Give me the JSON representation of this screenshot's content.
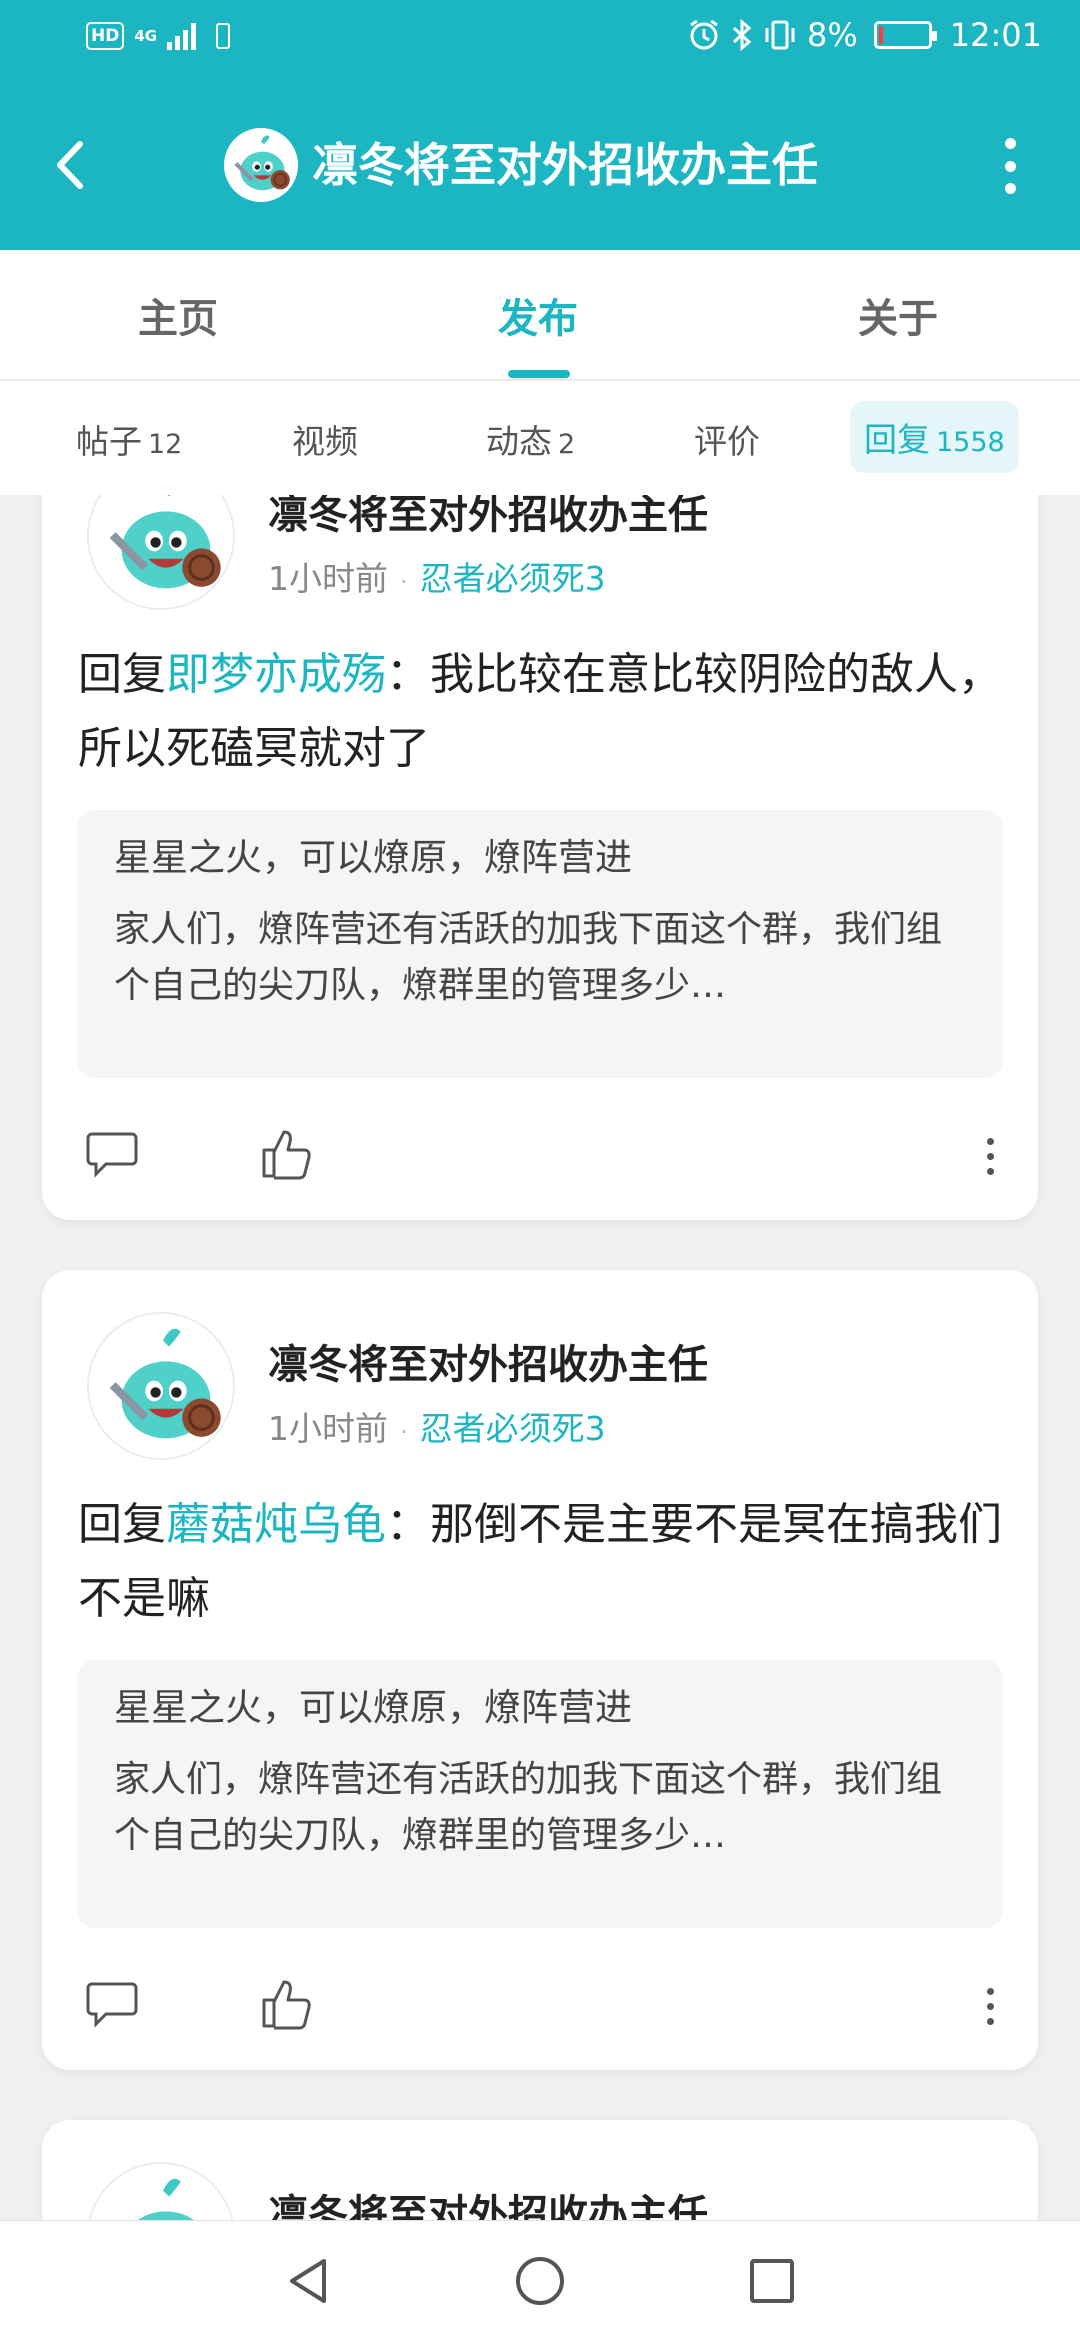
{
  "status_bar": {
    "hd": "HD",
    "network": "4G",
    "battery_percent": "8%",
    "battery_level": 0.08,
    "time": "12:01"
  },
  "header": {
    "title": "凛冬将至对外招收办主任"
  },
  "main_tabs": [
    {
      "label": "主页",
      "active": false
    },
    {
      "label": "发布",
      "active": true
    },
    {
      "label": "关于",
      "active": false
    }
  ],
  "sub_tabs": [
    {
      "label": "帖子",
      "count": "12",
      "active": false
    },
    {
      "label": "视频",
      "count": "",
      "active": false
    },
    {
      "label": "动态",
      "count": "2",
      "active": false
    },
    {
      "label": "评价",
      "count": "",
      "active": false
    },
    {
      "label": "回复",
      "count": "1558",
      "active": true
    }
  ],
  "posts": [
    {
      "author": "凛冬将至对外招收办主任",
      "time": "1小时前",
      "separator": "·",
      "forum": "忍者必须死3",
      "reply_prefix": "回复",
      "mention": "即梦亦成殇",
      "colon": "：",
      "reply_text": "我比较在意比较阴险的敌人，所以死磕冥就对了",
      "quote_title": "星星之火，可以燎原，燎阵营进",
      "quote_text": "家人们，燎阵营还有活跃的加我下面这个群，我们组个自己的尖刀队，燎群里的管理多少…"
    },
    {
      "author": "凛冬将至对外招收办主任",
      "time": "1小时前",
      "separator": "·",
      "forum": "忍者必须死3",
      "reply_prefix": "回复",
      "mention": "蘑菇炖乌龟",
      "colon": "：",
      "reply_text": "那倒不是主要不是冥在搞我们不是嘛",
      "quote_title": "星星之火，可以燎原，燎阵营进",
      "quote_text": "家人们，燎阵营还有活跃的加我下面这个群，我们组个自己的尖刀队，燎群里的管理多少…"
    },
    {
      "author": "凛冬将至对外招收办主任"
    }
  ],
  "colors": {
    "accent": "#1cb6c2",
    "background": "#f0f0f0",
    "quote_bg": "#f5f5f5",
    "battery_low": "#ff3b3b"
  },
  "icons": {
    "back": "back-arrow-icon",
    "more": "more-vertical-icon",
    "comment": "comment-bubble-icon",
    "like": "thumbs-up-icon",
    "nav_back": "triangle-back-icon",
    "nav_home": "circle-home-icon",
    "nav_recent": "square-recent-icon"
  }
}
